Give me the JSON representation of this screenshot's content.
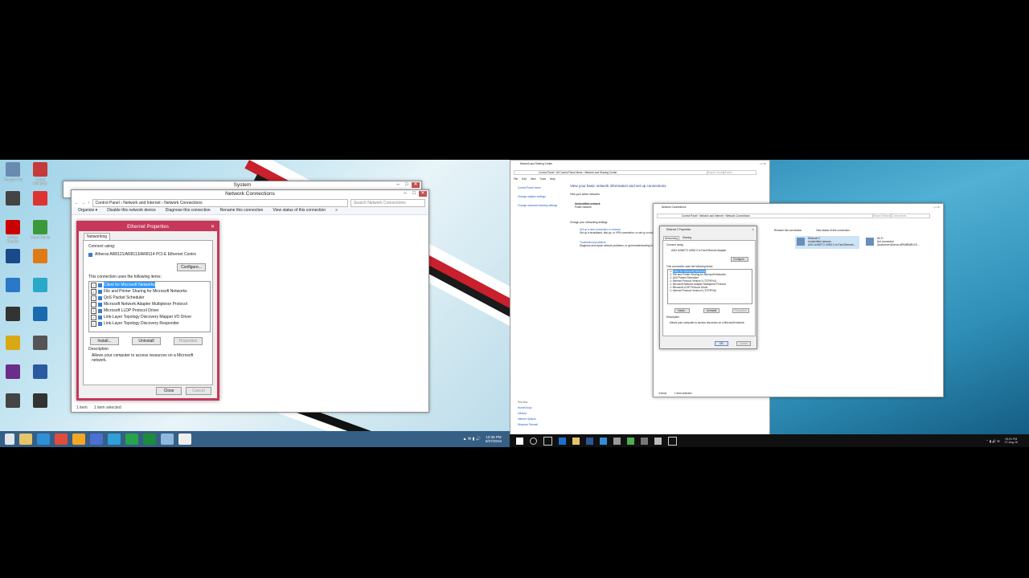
{
  "left": {
    "desktop_icons": [
      {
        "label": "Recycle Bin",
        "color": "#6a8bb0"
      },
      {
        "label": "Corel WinDVD",
        "color": "#c43b3b"
      },
      {
        "label": "",
        "color": "#444"
      },
      {
        "label": "",
        "color": "#d33"
      },
      {
        "label": "Adobe Reader",
        "color": "#c00"
      },
      {
        "label": "Corel Photo",
        "color": "#3a9a3a"
      },
      {
        "label": "",
        "color": "#1b4a8a"
      },
      {
        "label": "",
        "color": "#e07a16"
      },
      {
        "label": "",
        "color": "#2a78c8"
      },
      {
        "label": "",
        "color": "#2aa8c8"
      },
      {
        "label": "",
        "color": "#333"
      },
      {
        "label": "",
        "color": "#1a6ab0"
      },
      {
        "label": "",
        "color": "#d9a914"
      },
      {
        "label": "",
        "color": "#555"
      },
      {
        "label": "",
        "color": "#6b2c8a"
      },
      {
        "label": "",
        "color": "#2a5aa0"
      },
      {
        "label": "",
        "color": "#444"
      },
      {
        "label": "",
        "color": "#333"
      }
    ],
    "system_window": {
      "title": "System"
    },
    "netconn_window": {
      "title": "Network Connections",
      "breadcrumb": "Control Panel  ›  Network and Internet  ›  Network Connections",
      "search_placeholder": "Search Network Connections",
      "commands": [
        "Organize ▾",
        "Disable this network device",
        "Diagnose this connection",
        "Rename this connection",
        "View status of this connection",
        "»"
      ],
      "status_items": "1 item",
      "status_selected": "1 item selected"
    },
    "dialog": {
      "title": "Ethernet Properties",
      "tab": "Networking",
      "connect_using_label": "Connect using:",
      "adapter": "Atheros AR8121/AR8113/AR8114 PCI-E Ethernet Contro",
      "configure": "Configure...",
      "items_label": "This connection uses the following items:",
      "items": [
        {
          "label": "Client for Microsoft Networks",
          "checked": true,
          "selected": true
        },
        {
          "label": "File and Printer Sharing for Microsoft Networks",
          "checked": true,
          "selected": false
        },
        {
          "label": "QoS Packet Scheduler",
          "checked": true,
          "selected": false
        },
        {
          "label": "Microsoft Network Adapter Multiplexor Protocol",
          "checked": false,
          "selected": false
        },
        {
          "label": "Microsoft LLDP Protocol Driver",
          "checked": true,
          "selected": false
        },
        {
          "label": "Link-Layer Topology Discovery Mapper I/O Driver",
          "checked": true,
          "selected": false
        },
        {
          "label": "Link-Layer Topology Discovery Responder",
          "checked": true,
          "selected": false
        }
      ],
      "install": "Install...",
      "uninstall": "Uninstall",
      "properties": "Properties",
      "description_label": "Description",
      "description": "Allows your computer to access resources on a Microsoft network.",
      "close": "Close",
      "cancel": "Cancel"
    },
    "clock": {
      "time": "10:35 PM",
      "date": "8/27/2016"
    }
  },
  "right": {
    "nsc_window": {
      "title": "Network and Sharing Center",
      "breadcrumb": "Control Panel  ›  All Control Panel Items  ›  Network and Sharing Center",
      "menu": [
        "File",
        "Edit",
        "View",
        "Tools",
        "Help"
      ],
      "side_links": [
        "Control Panel Home",
        "Change adapter settings",
        "Change advanced sharing settings"
      ],
      "heading": "View your basic network information and set up connections",
      "active_label": "View your active networks",
      "network_name": "Unidentified network",
      "network_type": "Public network",
      "change_label": "Change your networking settings",
      "setup_link": "Set up a new connection or network",
      "setup_desc": "Set up a broadband, dial-up, or VPN connection; or set up a router or access point.",
      "trouble_link": "Troubleshoot problems",
      "trouble_desc": "Diagnose and repair network problems, or get troubleshooting information.",
      "see_also": [
        "See also",
        "HomeGroup",
        "Infrared",
        "Internet Options",
        "Windows Firewall"
      ]
    },
    "netconn_window": {
      "title": "Network Connections",
      "breadcrumb": "Control Panel  ›  Network and Internet  ›  Network Connections",
      "search_placeholder": "Search Network Connections",
      "commands": [
        "Rename this connection",
        "View status of this connection"
      ],
      "adapters": [
        {
          "name": "Ethernet 2",
          "status": "Unidentified network",
          "device": "ASIX AX88772 USB2.0 to Fast Ethernet..."
        },
        {
          "name": "Wi-Fi",
          "status": "Not connected",
          "device": "Qualcomm Atheros AR9485WB-EG..."
        }
      ],
      "status_items": "4 items",
      "status_selected": "1 item selected"
    },
    "dialog": {
      "title": "Ethernet 2 Properties",
      "tabs": [
        "Networking",
        "Sharing"
      ],
      "connect_using_label": "Connect using:",
      "adapter": "ASIX AX88772 USB2.0 to Fast Ethernet Adapter",
      "configure": "Configure...",
      "items_label": "This connection uses the following items:",
      "items": [
        {
          "label": "Client for Microsoft Networks",
          "selected": true
        },
        {
          "label": "File and Printer Sharing for Microsoft Networks",
          "selected": false
        },
        {
          "label": "QoS Packet Scheduler",
          "selected": false
        },
        {
          "label": "Internet Protocol Version 4 (TCP/IPv4)",
          "selected": false
        },
        {
          "label": "Microsoft Network Adapter Multiplexor Protocol",
          "selected": false
        },
        {
          "label": "Microsoft LLDP Protocol Driver",
          "selected": false
        },
        {
          "label": "Internet Protocol Version 6 (TCP/IPv6)",
          "selected": false
        }
      ],
      "install": "Install...",
      "uninstall": "Uninstall",
      "properties": "Properties",
      "description_label": "Description",
      "description": "Allows your computer to access resources on a Microsoft network.",
      "ok": "OK",
      "cancel": "Cancel"
    },
    "clock": {
      "time": "09:51 PM",
      "date": "27-Aug-16"
    }
  }
}
